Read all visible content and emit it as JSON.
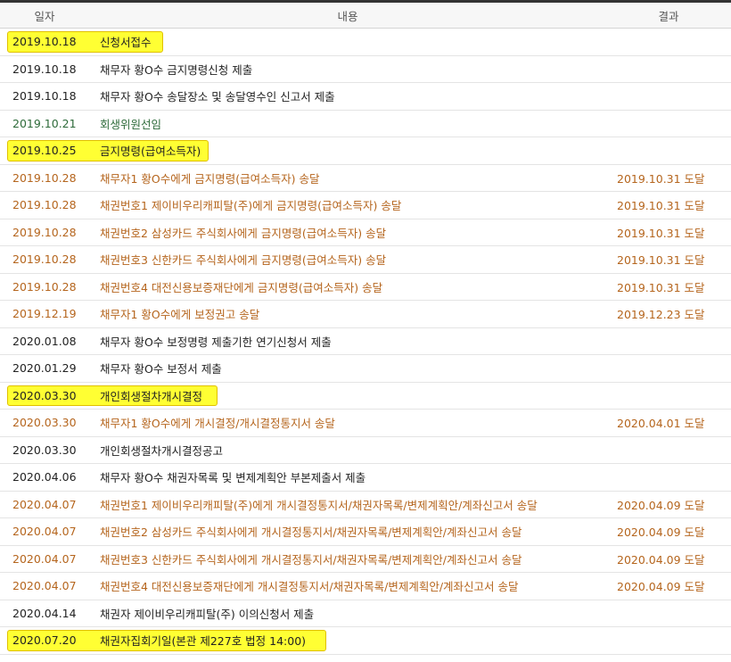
{
  "header": {
    "date": "일자",
    "content": "내용",
    "result": "결과"
  },
  "rows": [
    {
      "date": "2019.10.18",
      "content": "신청서접수",
      "result": "",
      "style": "yellow"
    },
    {
      "date": "2019.10.18",
      "content": "채무자 황O수 금지명령신청 제출",
      "result": "",
      "style": "black"
    },
    {
      "date": "2019.10.18",
      "content": "채무자 황O수 송달장소 및 송달영수인 신고서 제출",
      "result": "",
      "style": "black"
    },
    {
      "date": "2019.10.21",
      "content": "회생위원선임",
      "result": "",
      "style": "green"
    },
    {
      "date": "2019.10.25",
      "content": "금지명령(급여소득자)",
      "result": "",
      "style": "yellow"
    },
    {
      "date": "2019.10.28",
      "content": "채무자1 황O수에게 금지명령(급여소득자) 송달",
      "result": "2019.10.31 도달",
      "style": "orange"
    },
    {
      "date": "2019.10.28",
      "content": "채권번호1 제이비우리캐피탈(주)에게 금지명령(급여소득자) 송달",
      "result": "2019.10.31 도달",
      "style": "orange"
    },
    {
      "date": "2019.10.28",
      "content": "채권번호2 삼성카드 주식회사에게 금지명령(급여소득자) 송달",
      "result": "2019.10.31 도달",
      "style": "orange"
    },
    {
      "date": "2019.10.28",
      "content": "채권번호3 신한카드 주식회사에게 금지명령(급여소득자) 송달",
      "result": "2019.10.31 도달",
      "style": "orange"
    },
    {
      "date": "2019.10.28",
      "content": "채권번호4 대전신용보증재단에게 금지명령(급여소득자) 송달",
      "result": "2019.10.31 도달",
      "style": "orange"
    },
    {
      "date": "2019.12.19",
      "content": "채무자1 황O수에게 보정권고 송달",
      "result": "2019.12.23 도달",
      "style": "orange"
    },
    {
      "date": "2020.01.08",
      "content": "채무자 황O수 보정명령 제출기한 연기신청서 제출",
      "result": "",
      "style": "black"
    },
    {
      "date": "2020.01.29",
      "content": "채무자 황O수 보정서 제출",
      "result": "",
      "style": "black"
    },
    {
      "date": "2020.03.30",
      "content": "개인회생절차개시결정",
      "result": "",
      "style": "yellow"
    },
    {
      "date": "2020.03.30",
      "content": "채무자1 황O수에게 개시결정/개시결정통지서 송달",
      "result": "2020.04.01 도달",
      "style": "orange"
    },
    {
      "date": "2020.03.30",
      "content": "개인회생절차개시결정공고",
      "result": "",
      "style": "black"
    },
    {
      "date": "2020.04.06",
      "content": "채무자 황O수 채권자목록 및 변제계획안 부본제출서 제출",
      "result": "",
      "style": "black"
    },
    {
      "date": "2020.04.07",
      "content": "채권번호1 제이비우리캐피탈(주)에게 개시결정통지서/채권자목록/변제계획안/계좌신고서 송달",
      "result": "2020.04.09 도달",
      "style": "orange"
    },
    {
      "date": "2020.04.07",
      "content": "채권번호2 삼성카드 주식회사에게 개시결정통지서/채권자목록/변제계획안/계좌신고서 송달",
      "result": "2020.04.09 도달",
      "style": "orange"
    },
    {
      "date": "2020.04.07",
      "content": "채권번호3 신한카드 주식회사에게 개시결정통지서/채권자목록/변제계획안/계좌신고서 송달",
      "result": "2020.04.09 도달",
      "style": "orange"
    },
    {
      "date": "2020.04.07",
      "content": "채권번호4 대전신용보증재단에게 개시결정통지서/채권자목록/변제계획안/계좌신고서 송달",
      "result": "2020.04.09 도달",
      "style": "orange"
    },
    {
      "date": "2020.04.14",
      "content": "채권자 제이비우리캐피탈(주) 이의신청서 제출",
      "result": "",
      "style": "black"
    },
    {
      "date": "2020.07.20",
      "content": "채권자집회기일(본관 제227호 법정 14:00)",
      "result": "",
      "style": "yellow"
    }
  ],
  "colors": {
    "black": "#222222",
    "green": "#2e6b3a",
    "orange": "#b5651d",
    "highlight": "#ffff33",
    "highlight_border": "#e0c000"
  }
}
